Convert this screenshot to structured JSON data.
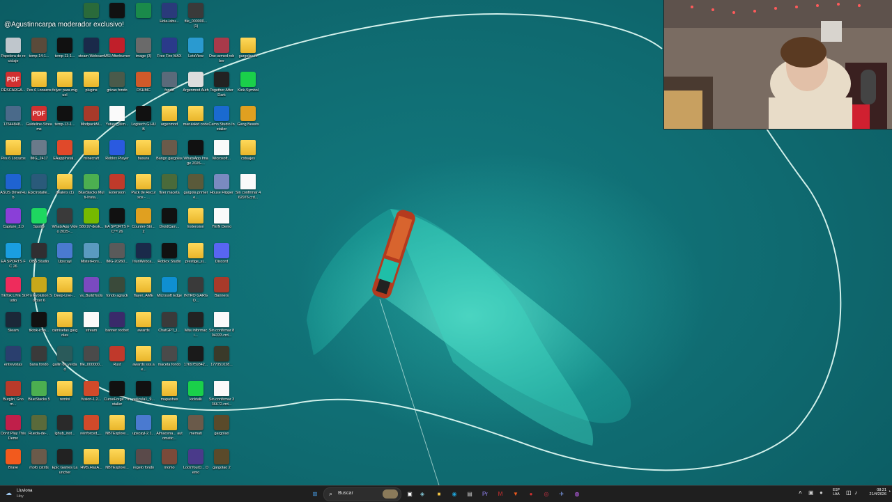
{
  "overlay": {
    "channel_text": "@Agustinncarpa moderador exclusivo!"
  },
  "desktop_icons": [
    {
      "label": "Papelera de reciclaje",
      "kind": "bin",
      "color": "#bfc6cc"
    },
    {
      "label": "DESCARGA...",
      "kind": "pdf",
      "color": "#d03030"
    },
    {
      "label": "17644848...",
      "kind": "thumb",
      "color": "#4a6a8a"
    },
    {
      "label": "Pes 6 Locazos",
      "kind": "folder",
      "color": "#f3c443"
    },
    {
      "label": "ASUS DriverHub",
      "kind": "app",
      "color": "#1f63d1"
    },
    {
      "label": "Capture_2.0",
      "kind": "app",
      "color": "#8a3fd8"
    },
    {
      "label": "EA SPORTS FC 26",
      "kind": "app",
      "color": "#1a9ee0"
    },
    {
      "label": "TikTok LIVE Studio",
      "kind": "app",
      "color": "#ee2c5c"
    },
    {
      "label": "Steam",
      "kind": "app",
      "color": "#1b2838"
    },
    {
      "label": "entrevistas",
      "kind": "thumb",
      "color": "#2a3f6e"
    },
    {
      "label": "Burglin' Gnom...",
      "kind": "app",
      "color": "#b83a2a"
    },
    {
      "label": "Don't Play This Demo",
      "kind": "app",
      "color": "#c01f4a"
    },
    {
      "label": "Brave",
      "kind": "app",
      "color": "#f25a1d"
    },
    {
      "label": "temp-14-1...",
      "kind": "thumb",
      "color": "#5a4a3a"
    },
    {
      "label": "Pes 6 Locazos",
      "kind": "folder",
      "color": "#f3c443"
    },
    {
      "label": "Guideline-Streams",
      "kind": "pdf",
      "color": "#d03030"
    },
    {
      "label": "IMG_2417",
      "kind": "thumb",
      "color": "#6a7a8a"
    },
    {
      "label": "EpicInstalle...",
      "kind": "app",
      "color": "#2a5a7a"
    },
    {
      "label": "Spotify",
      "kind": "app",
      "color": "#1ed760"
    },
    {
      "label": "OBS Studio",
      "kind": "app",
      "color": "#302e31"
    },
    {
      "label": "Pro Evolution Soccer 6",
      "kind": "app",
      "color": "#c8a81a"
    },
    {
      "label": "tiktok-icon...",
      "kind": "app",
      "color": "#111111"
    },
    {
      "label": "bana fondo",
      "kind": "thumb",
      "color": "#3a3a3a"
    },
    {
      "label": "BlueStacks 5",
      "kind": "app",
      "color": "#4caf50"
    },
    {
      "label": "Rueda-de-...",
      "kind": "thumb",
      "color": "#5a6a3a"
    },
    {
      "label": "mofo cstrits",
      "kind": "thumb",
      "color": "#6a5a4a"
    },
    {
      "label": "temp-11-1...",
      "kind": "dark",
      "color": "#111111"
    },
    {
      "label": "felyer para miguel",
      "kind": "folder",
      "color": "#f3c443"
    },
    {
      "label": "temp-13-1...",
      "kind": "dark",
      "color": "#111111"
    },
    {
      "label": "EAappInstal...",
      "kind": "app",
      "color": "#e0492a"
    },
    {
      "label": "dealers (1)",
      "kind": "folder",
      "color": "#f3c443"
    },
    {
      "label": "WhatsApp Video 2025-...",
      "kind": "thumb",
      "color": "#3a3a3a"
    },
    {
      "label": "Upscayl",
      "kind": "app",
      "color": "#4a7ad0"
    },
    {
      "label": "Deep-Live-...",
      "kind": "folder",
      "color": "#f3c443"
    },
    {
      "label": "camisetas gargolas",
      "kind": "folder",
      "color": "#f3c443"
    },
    {
      "label": "gallin de verdad",
      "kind": "thumb",
      "color": "#2a5a5a"
    },
    {
      "label": "remini",
      "kind": "folder",
      "color": "#f3c443"
    },
    {
      "label": "lghub_inst...",
      "kind": "app",
      "color": "#2a2a2a"
    },
    {
      "label": "Epic Games Launcher",
      "kind": "app",
      "color": "#222222"
    },
    {
      "label": "steam Webcam",
      "kind": "app",
      "color": "#1a2a4a"
    },
    {
      "label": "plugins",
      "kind": "folder",
      "color": "#f3c443"
    },
    {
      "label": "ModpackM...",
      "kind": "app",
      "color": "#a83a2a"
    },
    {
      "label": "minecraft",
      "kind": "folder",
      "color": "#f3c443"
    },
    {
      "label": "BlueStacks Multi-Insta...",
      "kind": "app",
      "color": "#4caf50"
    },
    {
      "label": "580.97-desk...",
      "kind": "app",
      "color": "#76b900"
    },
    {
      "label": "MisterHors...",
      "kind": "app",
      "color": "#5a9ac0"
    },
    {
      "label": "vs_BuildTools",
      "kind": "app",
      "color": "#7a4ac0"
    },
    {
      "label": "stream",
      "kind": "doc",
      "color": "#fafafa"
    },
    {
      "label": "file_000000...",
      "kind": "thumb",
      "color": "#4a4a4a"
    },
    {
      "label": "fusion-1.2...",
      "kind": "app",
      "color": "#d04a2a"
    },
    {
      "label": "reinforced_...",
      "kind": "app",
      "color": "#d04a2a"
    },
    {
      "label": "HMS.HasA...",
      "kind": "folder",
      "color": "#f3c443"
    },
    {
      "label": "MSI Afterburner",
      "kind": "app",
      "color": "#c01f2a"
    },
    {
      "label": "grizas fondo",
      "kind": "thumb",
      "color": "#4a5a4a"
    },
    {
      "label": "Yuture_elim...",
      "kind": "doc",
      "color": "#fafafa"
    },
    {
      "label": "Roblox Player",
      "kind": "app",
      "color": "#2a5ae0"
    },
    {
      "label": "Extension",
      "kind": "app",
      "color": "#c03a2a"
    },
    {
      "label": "EA SPORTS FC™ 26",
      "kind": "app",
      "color": "#111111"
    },
    {
      "label": "IMG-20260...",
      "kind": "thumb",
      "color": "#5a5a5a"
    },
    {
      "label": "fondo agruck",
      "kind": "thumb",
      "color": "#3a4a3a"
    },
    {
      "label": "banner roobet",
      "kind": "app",
      "color": "#3a2a6a"
    },
    {
      "label": "Rust",
      "kind": "app",
      "color": "#c0392b"
    },
    {
      "label": "CurseForge - Installer",
      "kind": "app",
      "color": "#111111"
    },
    {
      "label": "NBTExplore...",
      "kind": "folder",
      "color": "#f3c443"
    },
    {
      "label": "NBTExplore...",
      "kind": "folder",
      "color": "#f3c443"
    },
    {
      "label": "image (3)",
      "kind": "thumb",
      "color": "#6a6a6a"
    },
    {
      "label": "DSHMC",
      "kind": "app",
      "color": "#d05a2a"
    },
    {
      "label": "Logitech G HUB",
      "kind": "app",
      "color": "#111111"
    },
    {
      "label": "basura",
      "kind": "folder",
      "color": "#f3c443"
    },
    {
      "label": "Pack de Recursos - ...",
      "kind": "folder",
      "color": "#f3c443"
    },
    {
      "label": "Counter-Stri... 2",
      "kind": "app",
      "color": "#e0a020"
    },
    {
      "label": "IriunWebca...",
      "kind": "app",
      "color": "#1a2a4a"
    },
    {
      "label": "flayer_AME",
      "kind": "folder",
      "color": "#f3c443"
    },
    {
      "label": "awards",
      "kind": "folder",
      "color": "#f3c443"
    },
    {
      "label": "awards sss.ae...",
      "kind": "folder",
      "color": "#f3c443"
    },
    {
      "label": "pelicula1_9...",
      "kind": "dark",
      "color": "#111111"
    },
    {
      "label": "upscayl-2.1...",
      "kind": "app",
      "color": "#4a7ad0"
    },
    {
      "label": "regelo fondo",
      "kind": "thumb",
      "color": "#5a4a4a"
    },
    {
      "label": "Free Fire MAX",
      "kind": "app",
      "color": "#2a3a8a"
    },
    {
      "label": "fondo",
      "kind": "thumb",
      "color": "#5a6a7a"
    },
    {
      "label": "argenmod",
      "kind": "folder",
      "color": "#f3c443"
    },
    {
      "label": "Bango gargolas",
      "kind": "thumb",
      "color": "#6a5a4a"
    },
    {
      "label": "flyer maceta",
      "kind": "thumb",
      "color": "#4a6a3a"
    },
    {
      "label": "DroidCam...",
      "kind": "app",
      "color": "#111111"
    },
    {
      "label": "Roblox Studio",
      "kind": "app",
      "color": "#111111"
    },
    {
      "label": "Microsoft Edge",
      "kind": "app",
      "color": "#0f8fd1"
    },
    {
      "label": "ChatGPT_I...",
      "kind": "thumb",
      "color": "#3a3a3a"
    },
    {
      "label": "maceta fondo",
      "kind": "thumb",
      "color": "#4a4a4a"
    },
    {
      "label": "mapashax",
      "kind": "folder",
      "color": "#f3c443"
    },
    {
      "label": "Almacena... automatic...",
      "kind": "folder",
      "color": "#f3c443"
    },
    {
      "label": "momo",
      "kind": "thumb",
      "color": "#7a4a3a"
    },
    {
      "label": "LetsView",
      "kind": "app",
      "color": "#2a9ad0"
    },
    {
      "label": "Argenmod Auth",
      "kind": "app",
      "color": "#dddddd"
    },
    {
      "label": "marulakid code",
      "kind": "folder",
      "color": "#f3c443"
    },
    {
      "label": "WhatsApp Image 2026-...",
      "kind": "dark",
      "color": "#111111"
    },
    {
      "label": "gargola primer e...",
      "kind": "thumb",
      "color": "#5a5a3a"
    },
    {
      "label": "Extension",
      "kind": "folder",
      "color": "#f3c443"
    },
    {
      "label": "prestige_si...",
      "kind": "folder",
      "color": "#f3c443"
    },
    {
      "label": "INTRO GARGO...",
      "kind": "thumb",
      "color": "#3a3a3a"
    },
    {
      "label": "Más informaci...",
      "kind": "app",
      "color": "#222222"
    },
    {
      "label": "1769759342...",
      "kind": "thumb",
      "color": "#1a1a1a"
    },
    {
      "label": "kicktalk",
      "kind": "app",
      "color": "#1ad04a"
    },
    {
      "label": "memati",
      "kind": "thumb",
      "color": "#6a5a4a"
    },
    {
      "label": "LockYourD... Demo",
      "kind": "app",
      "color": "#4a3a8a"
    },
    {
      "label": "One-armed robber",
      "kind": "app",
      "color": "#a83a4a"
    },
    {
      "label": "Together After Dark",
      "kind": "app",
      "color": "#222222"
    },
    {
      "label": "Camo Studio Installer",
      "kind": "app",
      "color": "#1a6ad0"
    },
    {
      "label": "Microsoft...",
      "kind": "doc",
      "color": "#fafafa"
    },
    {
      "label": "House Flipper",
      "kind": "app",
      "color": "#7a8ac0"
    },
    {
      "label": "YEIN Demo",
      "kind": "doc",
      "color": "#fafafa"
    },
    {
      "label": "Discord",
      "kind": "app",
      "color": "#5865f2"
    },
    {
      "label": "Banners",
      "kind": "app",
      "color": "#a83a2a"
    },
    {
      "label": "Sin confirmar 894333.crd...",
      "kind": "doc",
      "color": "#fafafa"
    },
    {
      "label": "177051028...",
      "kind": "thumb",
      "color": "#3a3a2a"
    },
    {
      "label": "Sin confirmar 336672.crd...",
      "kind": "doc",
      "color": "#fafafa"
    },
    {
      "label": "gargolao",
      "kind": "thumb",
      "color": "#5a4a2a"
    },
    {
      "label": "gargolao 2",
      "kind": "thumb",
      "color": "#5a4a2a"
    },
    {
      "label": "gargolao fc",
      "kind": "folder",
      "color": "#f3c443"
    },
    {
      "label": "Kick-Symbol",
      "kind": "app",
      "color": "#1ad04a"
    },
    {
      "label": "Gang Beasts",
      "kind": "app",
      "color": "#e0a020"
    },
    {
      "label": "cstuajes",
      "kind": "folder",
      "color": "#f3c443"
    },
    {
      "label": "Sin confirmar 462976.crd...",
      "kind": "doc",
      "color": "#fafafa"
    }
  ],
  "top_row_icons": [
    {
      "label": "",
      "kind": "thumb",
      "color": "#2a6a3a"
    },
    {
      "label": "",
      "kind": "app",
      "color": "#111111"
    },
    {
      "label": "",
      "kind": "thumb",
      "color": "#1a8a4a"
    },
    {
      "label": "Hola-labu...",
      "kind": "app",
      "color": "#2a3a7a"
    },
    {
      "label": "file_000000... (1)",
      "kind": "thumb",
      "color": "#3a3a3a"
    }
  ],
  "taskbar": {
    "weather_temp": "Lluviona",
    "weather_sub": "Hoy",
    "search_placeholder": "Buscar",
    "lang_top": "ESP",
    "lang_bottom": "LAA",
    "time": "08:21",
    "date": "21/4/2026",
    "apps": [
      {
        "name": "windows-start-icon",
        "glyph": "⊞",
        "color": "#4aa3f0"
      },
      {
        "name": "task-view-icon",
        "glyph": "▣",
        "color": "#ffffff"
      },
      {
        "name": "copilot-icon",
        "glyph": "◈",
        "color": "#8ad0e0"
      },
      {
        "name": "file-explorer-icon",
        "glyph": "■",
        "color": "#f3c443"
      },
      {
        "name": "edge-icon",
        "glyph": "◉",
        "color": "#1fa3d8"
      },
      {
        "name": "notepad-icon",
        "glyph": "▤",
        "color": "#cccccc"
      },
      {
        "name": "premiere-icon",
        "glyph": "Pr",
        "color": "#9a8aff"
      },
      {
        "name": "msi-icon",
        "glyph": "M",
        "color": "#d03030"
      },
      {
        "name": "brave-icon",
        "glyph": "▼",
        "color": "#f25a1d"
      },
      {
        "name": "recorder-icon",
        "glyph": "●",
        "color": "#d03030"
      },
      {
        "name": "kick-app-icon",
        "glyph": "◎",
        "color": "#cc3344"
      },
      {
        "name": "steam-task-icon",
        "glyph": "✈",
        "color": "#88aaff"
      },
      {
        "name": "obs-task-icon",
        "glyph": "◍",
        "color": "#cc66ff"
      }
    ]
  }
}
